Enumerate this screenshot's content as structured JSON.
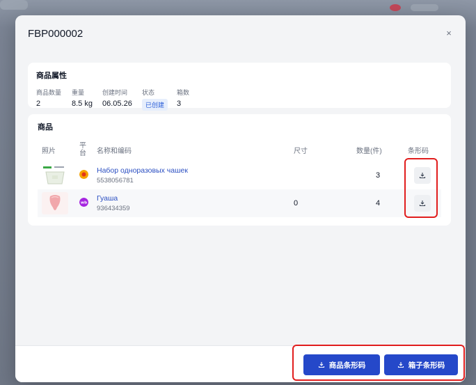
{
  "modal": {
    "title": "FBP000002",
    "close_label": "×"
  },
  "attributes": {
    "title": "商品属性",
    "fields": [
      {
        "label": "商品数量",
        "value": "2"
      },
      {
        "label": "重量",
        "value": "8.5 kg"
      },
      {
        "label": "创建时间",
        "value": "06.05.26"
      },
      {
        "label": "状态",
        "value": "已创建"
      },
      {
        "label": "箱数",
        "value": "3"
      }
    ]
  },
  "products": {
    "title": "商品",
    "headers": {
      "photo": "照片",
      "platform": "平台",
      "name": "名称和编码",
      "size": "尺寸",
      "qty": "数量(件)",
      "barcode": "条形码"
    },
    "rows": [
      {
        "name": "Набор одноразовых чашек",
        "code": "5538056781",
        "size": "",
        "qty": "3",
        "platform_icon": "ozon-orange-icon",
        "platform_color": "#f5a200"
      },
      {
        "name": "Гуаша",
        "code": "936434359",
        "size": "0",
        "qty": "4",
        "platform_icon": "wildberries-wb-icon",
        "platform_color": "#a626e0"
      }
    ]
  },
  "footer": {
    "product_barcode_label": "商品条形码",
    "box_barcode_label": "箱子条形码"
  },
  "colors": {
    "primary": "#2548c9",
    "highlight": "#e11d1d",
    "link": "#2b4fc2"
  }
}
